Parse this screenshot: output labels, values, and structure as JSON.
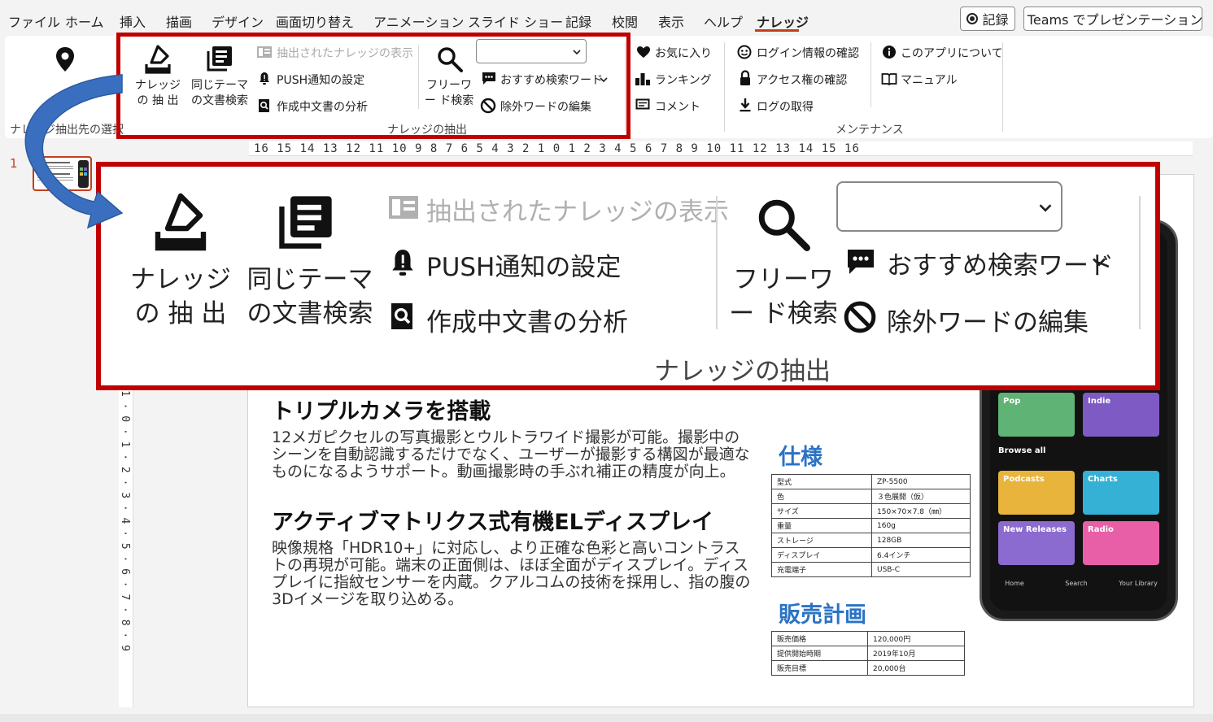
{
  "menu": {
    "items": [
      "ファイル",
      "ホーム",
      "挿入",
      "描画",
      "デザイン",
      "画面切り替え",
      "アニメーション",
      "スライド ショー",
      "記録",
      "校閲",
      "表示",
      "ヘルプ",
      "ナレッジ"
    ],
    "record_button": "記録",
    "teams_button": "Teams でプレゼンテーション"
  },
  "ribbon": {
    "select_group": {
      "label_partial": "ナレッジ抽出先の選択"
    },
    "extract": {
      "knowledge_extract": "ナレッジ の 抽 出",
      "same_theme_search": "同じテーマ の文書検索",
      "show_extracted": "抽出されたナレッジの表示",
      "push_settings": "PUSH通知の設定",
      "analyze_doc": "作成中文書の分析",
      "freeword_search": "フリーワー ド検索",
      "recommended_words": "おすすめ検索ワード",
      "exclude_words": "除外ワードの編集",
      "group_label": "ナレッジの抽出"
    },
    "favorites": "お気に入り",
    "ranking": "ランキング",
    "comment": "コメント",
    "login_check": "ログイン情報の確認",
    "access_check": "アクセス権の確認",
    "get_log": "ログの取得",
    "about_app": "このアプリについて",
    "manual": "マニュアル",
    "maintenance_label": "メンテナンス"
  },
  "ruler": {
    "horizontal": "16 15 14 13 12 11 10 9 8 7 6 5 4 3 2 1 0 1 2 3 4 5 6 7 8 9 10 11 12 13 14 15 16",
    "vertical": "1 · 0 · 1 · 2 · 3 · 4 · 5 · 6 · 7 · 8 · 9"
  },
  "slide_panel": {
    "number": "1"
  },
  "slide": {
    "heading1": "トリプルカメラを搭載",
    "para1": "12メガピクセルの写真撮影とウルトラワイド撮影が可能。撮影中のシーンを自動認識するだけでなく、ユーザーが撮影する構図が最適なものになるようサポート。動画撮影時の手ぶれ補正の精度が向上。",
    "heading2": "アクティブマトリクス式有機ELディスプレイ",
    "para2": "映像規格「HDR10+」に対応し、より正確な色彩と高いコントラストの再現が可能。端末の正面側は、ほぼ全面がディスプレイ。ディスプレイに指紋センサーを内蔵。クアルコムの技術を採用し、指の腹の3Dイメージを取り込める。",
    "spec_title": "仕様",
    "spec_rows": [
      [
        "型式",
        "ZP-5500"
      ],
      [
        "色",
        "３色展開（仮）"
      ],
      [
        "サイズ",
        "150×70×7.8（㎜）"
      ],
      [
        "重量",
        "160g"
      ],
      [
        "ストレージ",
        "128GB"
      ],
      [
        "ディスプレイ",
        "6.4インチ"
      ],
      [
        "充電端子",
        "USB-C"
      ]
    ],
    "sales_title": "販売計画",
    "sales_rows": [
      [
        "販売価格",
        "120,000円"
      ],
      [
        "提供開始時期",
        "2019年10月"
      ],
      [
        "販売目標",
        "20,000台"
      ]
    ]
  },
  "phone": {
    "tiles": [
      "Pop",
      "Indie",
      "Podcasts",
      "Charts",
      "New Releases",
      "Radio"
    ],
    "browse_all": "Browse all",
    "nav": [
      "Home",
      "Search",
      "Your Library"
    ]
  },
  "colors": {
    "accent": "#c43e1c",
    "callout": "#c00000",
    "heading_blue": "#2b73c4",
    "arrow": "#3a6fc0"
  }
}
